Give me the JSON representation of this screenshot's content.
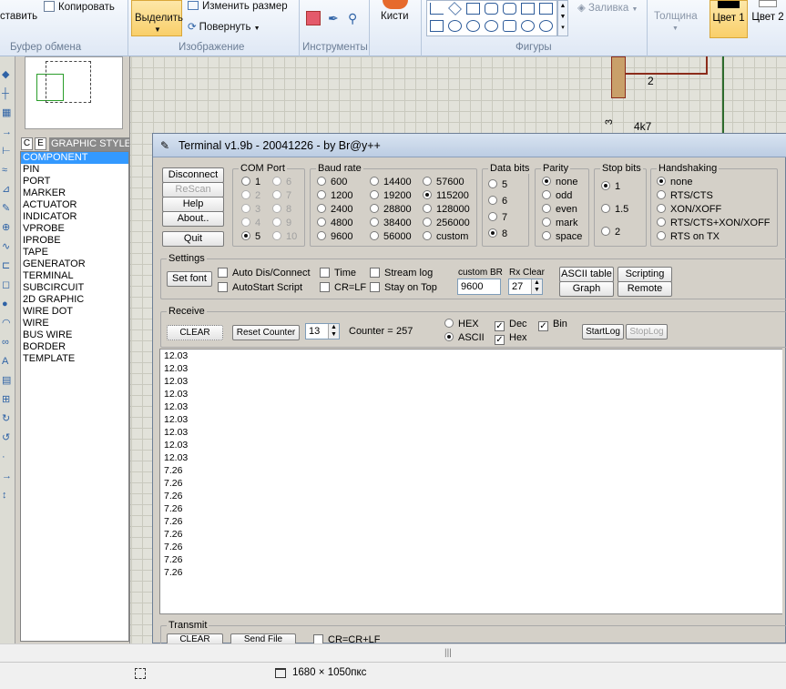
{
  "ribbon": {
    "paste": "ставить",
    "copy": "Копировать",
    "select": "Выделить",
    "resize": "Изменить размер",
    "rotate": "Повернуть",
    "brushes": "Кисти",
    "fill": "Заливка",
    "thickness": "Толщина",
    "color1": "Цвет 1",
    "color2": "Цвет 2",
    "group_clipboard": "Буфер обмена",
    "group_image": "Изображение",
    "group_tools": "Инструменты",
    "group_shapes": "Фигуры"
  },
  "object_panel": {
    "tab_c": "C",
    "tab_e": "E",
    "title": "GRAPHIC STYLES",
    "items": [
      "COMPONENT",
      "PIN",
      "PORT",
      "MARKER",
      "ACTUATOR",
      "INDICATOR",
      "VPROBE",
      "IPROBE",
      "TAPE",
      "GENERATOR",
      "TERMINAL",
      "SUBCIRCUIT",
      "2D GRAPHIC",
      "WIRE DOT",
      "WIRE",
      "BUS WIRE",
      "BORDER",
      "TEMPLATE"
    ]
  },
  "schematic": {
    "label_2": "2",
    "label_3": "3",
    "label_4k7": "4k7"
  },
  "terminal": {
    "title": "Terminal v1.9b - 20041226 - by Br@y++",
    "buttons": {
      "disconnect": "Disconnect",
      "rescan": "ReScan",
      "help": "Help",
      "about": "About..",
      "quit": "Quit"
    },
    "com_port": {
      "legend": "COM Port",
      "ports": [
        "1",
        "2",
        "3",
        "4",
        "5",
        "6",
        "7",
        "8",
        "9",
        "10"
      ],
      "selected": "5"
    },
    "baud_rate": {
      "legend": "Baud rate",
      "rates": [
        "600",
        "1200",
        "2400",
        "4800",
        "9600",
        "14400",
        "19200",
        "28800",
        "38400",
        "56000",
        "57600",
        "115200",
        "128000",
        "256000",
        "custom"
      ],
      "selected": "115200"
    },
    "data_bits": {
      "legend": "Data bits",
      "options": [
        "5",
        "6",
        "7",
        "8"
      ],
      "selected": "8"
    },
    "parity": {
      "legend": "Parity",
      "options": [
        "none",
        "odd",
        "even",
        "mark",
        "space"
      ],
      "selected": "none"
    },
    "stop_bits": {
      "legend": "Stop bits",
      "options": [
        "1",
        "1.5",
        "2"
      ],
      "selected": "1"
    },
    "handshaking": {
      "legend": "Handshaking",
      "options": [
        "none",
        "RTS/CTS",
        "XON/XOFF",
        "RTS/CTS+XON/XOFF",
        "RTS on TX"
      ],
      "selected": "none"
    },
    "settings": {
      "legend": "Settings",
      "set_font": "Set font",
      "auto_dis_connect": "Auto Dis/Connect",
      "autostart_script": "AutoStart Script",
      "time": "Time",
      "cr_lf": "CR=LF",
      "stream_log": "Stream log",
      "stay_on_top": "Stay on Top",
      "custom_br_label": "custom BR",
      "custom_br_value": "9600",
      "rx_clear_label": "Rx Clear",
      "rx_clear_value": "27",
      "ascii_table": "ASCII table",
      "scripting": "Scripting",
      "graph": "Graph",
      "remote": "Remote"
    },
    "receive": {
      "legend": "Receive",
      "clear": "CLEAR",
      "reset_counter": "Reset Counter",
      "counter_spin": "13",
      "counter_label": "Counter =",
      "counter_value": "257",
      "hex": "HEX",
      "ascii": "ASCII",
      "dec": "Dec",
      "hex_cb": "Hex",
      "bin": "Bin",
      "start_log": "StartLog",
      "stop_log": "StopLog",
      "lines": [
        "12.03",
        "12.03",
        "12.03",
        "12.03",
        "12.03",
        "12.03",
        "12.03",
        "12.03",
        "12.03",
        "7.26",
        "7.26",
        "7.26",
        "7.26",
        "7.26",
        "7.26",
        "7.26",
        "7.26",
        "7.26"
      ]
    },
    "transmit": {
      "legend": "Transmit",
      "clear": "CLEAR",
      "send_file": "Send File",
      "cr_crlf": "CR=CR+LF"
    }
  },
  "statusbar": {
    "dimensions": "1680 × 1050пкс"
  }
}
